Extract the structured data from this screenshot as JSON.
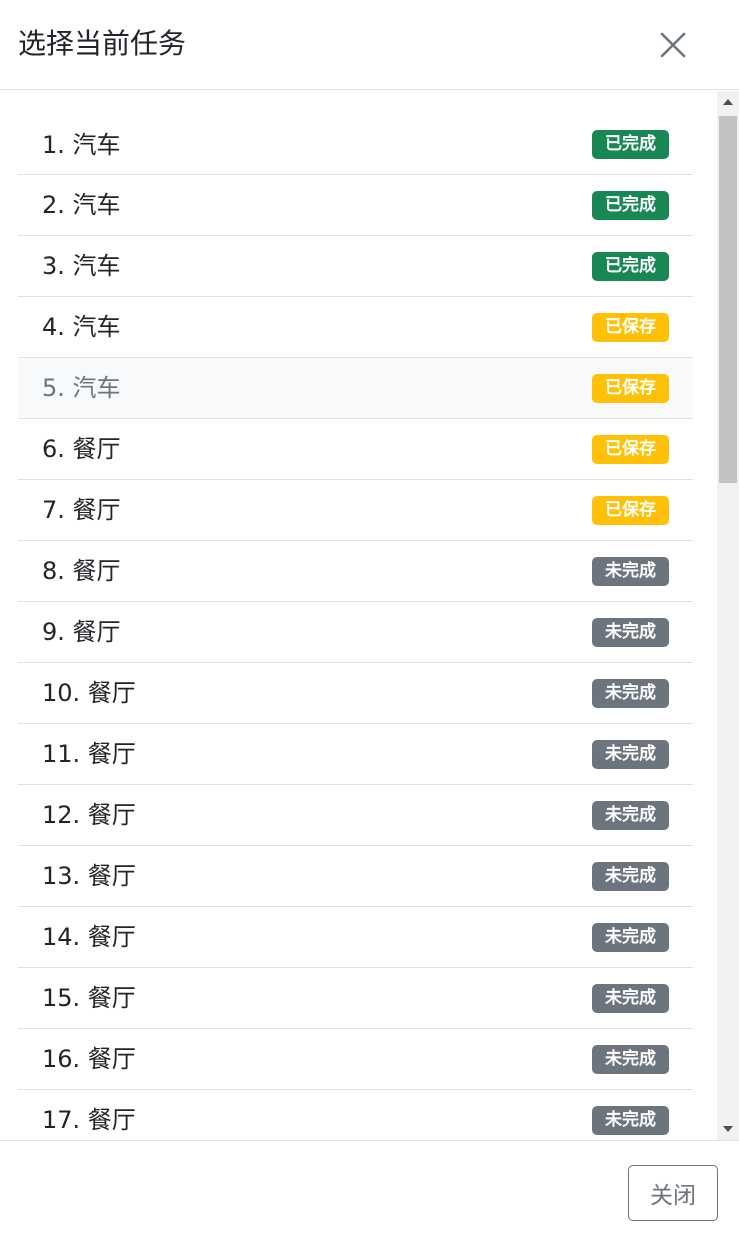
{
  "modal": {
    "title": "选择当前任务",
    "close_icon": "close-icon",
    "footer_close_label": "关闭"
  },
  "colors": {
    "completed": "#198754",
    "saved": "#ffc107",
    "incomplete": "#6c757d"
  },
  "tasks": [
    {
      "label": "1. 汽车",
      "status": "已完成",
      "status_type": "completed"
    },
    {
      "label": "2. 汽车",
      "status": "已完成",
      "status_type": "completed"
    },
    {
      "label": "3. 汽车",
      "status": "已完成",
      "status_type": "completed"
    },
    {
      "label": "4. 汽车",
      "status": "已保存",
      "status_type": "saved"
    },
    {
      "label": "5. 汽车",
      "status": "已保存",
      "status_type": "saved",
      "active": true
    },
    {
      "label": "6. 餐厅",
      "status": "已保存",
      "status_type": "saved"
    },
    {
      "label": "7. 餐厅",
      "status": "已保存",
      "status_type": "saved"
    },
    {
      "label": "8. 餐厅",
      "status": "未完成",
      "status_type": "incomplete"
    },
    {
      "label": "9. 餐厅",
      "status": "未完成",
      "status_type": "incomplete"
    },
    {
      "label": "10. 餐厅",
      "status": "未完成",
      "status_type": "incomplete"
    },
    {
      "label": "11. 餐厅",
      "status": "未完成",
      "status_type": "incomplete"
    },
    {
      "label": "12. 餐厅",
      "status": "未完成",
      "status_type": "incomplete"
    },
    {
      "label": "13. 餐厅",
      "status": "未完成",
      "status_type": "incomplete"
    },
    {
      "label": "14. 餐厅",
      "status": "未完成",
      "status_type": "incomplete"
    },
    {
      "label": "15. 餐厅",
      "status": "未完成",
      "status_type": "incomplete"
    },
    {
      "label": "16. 餐厅",
      "status": "未完成",
      "status_type": "incomplete"
    },
    {
      "label": "17. 餐厅",
      "status": "未完成",
      "status_type": "incomplete"
    }
  ]
}
